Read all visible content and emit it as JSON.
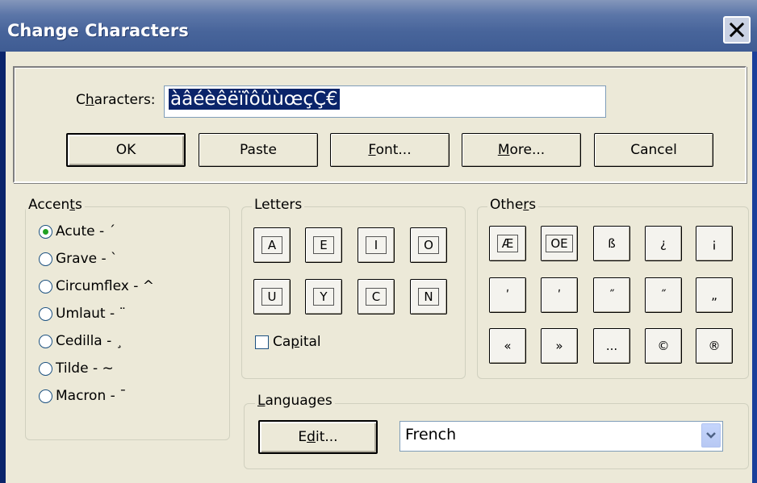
{
  "window": {
    "title": "Change Characters",
    "close_icon": "close-icon"
  },
  "characters": {
    "label_prefix": "C",
    "label_mnemonic": "h",
    "label_suffix": "aracters:",
    "value": "àâéèêëïîôûùœçÇ€"
  },
  "actions": {
    "ok": "OK",
    "paste": "Paste",
    "font_mnemonic": "F",
    "font_rest": "ont...",
    "more_mnemonic": "M",
    "more_rest": "ore...",
    "cancel": "Cancel"
  },
  "accents": {
    "legend_prefix": "Accen",
    "legend_mnemonic": "t",
    "legend_suffix": "s",
    "options": [
      {
        "label": "Acute - ´",
        "selected": true
      },
      {
        "label": "Grave - `",
        "selected": false
      },
      {
        "label": "Circumflex - ^",
        "selected": false
      },
      {
        "label": "Umlaut - ¨",
        "selected": false
      },
      {
        "label": "Cedilla - ¸",
        "selected": false
      },
      {
        "label": "Tilde - ~",
        "selected": false
      },
      {
        "label": "Macron - ¯",
        "selected": false
      }
    ]
  },
  "letters": {
    "legend": "Letters",
    "row1": [
      "A",
      "E",
      "I",
      "O"
    ],
    "row2": [
      "U",
      "Y",
      "C",
      "N"
    ],
    "capital_prefix": "Ca",
    "capital_mnemonic": "p",
    "capital_suffix": "ital",
    "capital_checked": false
  },
  "others": {
    "legend_prefix": "Othe",
    "legend_mnemonic": "r",
    "legend_suffix": "s",
    "row1": [
      "Æ",
      "OE",
      "ß",
      "¿",
      "¡"
    ],
    "row2": [
      "ʹ",
      "ʹ",
      "˝",
      "˝",
      "„"
    ],
    "row3": [
      "«",
      "»",
      "...",
      "©",
      "®"
    ]
  },
  "languages": {
    "legend_mnemonic": "L",
    "legend_rest": "anguages",
    "edit_prefix": "E",
    "edit_mnemonic": "d",
    "edit_suffix": "it...",
    "selected": "French",
    "dropdown_icon": "chevron-down-icon"
  },
  "colors": {
    "titlebar": "#48659b",
    "face": "#ece9d8",
    "selection": "#0a246a"
  }
}
